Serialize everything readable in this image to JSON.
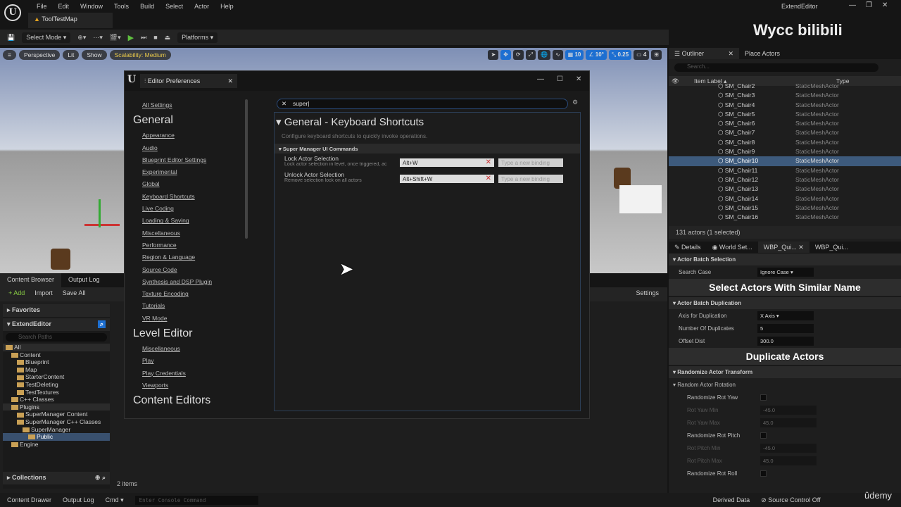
{
  "app": {
    "logo": "U",
    "menu": [
      "File",
      "Edit",
      "Window",
      "Tools",
      "Build",
      "Select",
      "Actor",
      "Help"
    ],
    "map_tab": "ToolTestMap",
    "window_title": "ExtendEditor",
    "watermark": "Wycc bilibili",
    "udemy": "ûdemy"
  },
  "toolbar": {
    "select_mode": "Select Mode",
    "platforms": "Platforms"
  },
  "viewport": {
    "perspective": "Perspective",
    "lit": "Lit",
    "show": "Show",
    "scalability": "Scalability: Medium",
    "grid": "10",
    "angle": "10°",
    "scale": "0.25",
    "camera": "4"
  },
  "content_browser": {
    "tabs": [
      "Content Browser",
      "Output Log"
    ],
    "add": "+ Add",
    "import": "Import",
    "save_all": "Save All",
    "settings": "Settings",
    "favorites": "Favorites",
    "project": "ExtendEditor",
    "search_paths": "Search Paths",
    "tree": [
      {
        "label": "All",
        "depth": 0
      },
      {
        "label": "Content",
        "depth": 1
      },
      {
        "label": "Blueprint",
        "depth": 2
      },
      {
        "label": "Map",
        "depth": 2
      },
      {
        "label": "StarterContent",
        "depth": 2
      },
      {
        "label": "TestDeleting",
        "depth": 2
      },
      {
        "label": "TestTextures",
        "depth": 2
      },
      {
        "label": "C++ Classes",
        "depth": 1
      },
      {
        "label": "Plugins",
        "depth": 1
      },
      {
        "label": "SuperManager Content",
        "depth": 2
      },
      {
        "label": "SuperManager C++ Classes",
        "depth": 2
      },
      {
        "label": "SuperManager",
        "depth": 3
      },
      {
        "label": "Public",
        "depth": 4
      },
      {
        "label": "Engine",
        "depth": 1
      }
    ],
    "collections": "Collections",
    "items": "2 items"
  },
  "status": {
    "content_drawer": "Content Drawer",
    "output_log": "Output Log",
    "cmd": "Cmd",
    "console_placeholder": "Enter Console Command",
    "derived_data": "Derived Data",
    "source_control": "Source Control Off"
  },
  "prefs": {
    "title": "Editor Preferences",
    "all_settings": "All Settings",
    "general": "General",
    "general_items": [
      "Appearance",
      "Audio",
      "Blueprint Editor Settings",
      "Experimental",
      "Global",
      "Keyboard Shortcuts",
      "Live Coding",
      "Loading & Saving",
      "Miscellaneous",
      "Performance",
      "Region & Language",
      "Source Code",
      "Synthesis and DSP Plugin",
      "Texture Encoding",
      "Tutorials",
      "VR Mode"
    ],
    "level_editor": "Level Editor",
    "level_items": [
      "Miscellaneous",
      "Play",
      "Play Credentials",
      "Viewports"
    ],
    "content_editors": "Content Editors",
    "search": "super",
    "section_title": "General - Keyboard Shortcuts",
    "section_desc": "Configure keyboard shortcuts to quickly invoke operations.",
    "group": "Super Manager UI Commands",
    "placeholder": "Type a new binding",
    "commands": [
      {
        "name": "Lock Actor Selection",
        "desc": "Lock actor selection in level, once triggered, ac",
        "key": "Alt+W"
      },
      {
        "name": "Unlock Actor Selection",
        "desc": "Remove selection lock on all actors",
        "key": "Alt+Shift+W"
      }
    ]
  },
  "outliner": {
    "tab": "Outliner",
    "place": "Place Actors",
    "search": "Search...",
    "col_label": "Item Label",
    "col_type": "Type",
    "rows": [
      "SM_Chair2",
      "SM_Chair3",
      "SM_Chair4",
      "SM_Chair5",
      "SM_Chair6",
      "SM_Chair7",
      "SM_Chair8",
      "SM_Chair9",
      "SM_Chair10",
      "SM_Chair11",
      "SM_Chair12",
      "SM_Chair13",
      "SM_Chair14",
      "SM_Chair15",
      "SM_Chair16"
    ],
    "type": "StaticMeshActor",
    "count": "131 actors (1 selected)"
  },
  "details": {
    "tabs": [
      "Details",
      "World Set...",
      "WBP_Qui...",
      "WBP_Qui..."
    ],
    "batch_sel": "Actor Batch Selection",
    "search_case": "Search Case",
    "search_case_val": "Ignore Case",
    "select_btn": "Select Actors With Similar Name",
    "batch_dup": "Actor Batch Duplication",
    "axis": "Axis for Duplication",
    "axis_val": "X Axis",
    "num": "Number Of Duplicates",
    "num_val": "5",
    "offset": "Offset Dist",
    "offset_val": "300.0",
    "dup_btn": "Duplicate Actors",
    "rand": "Randomize Actor Transform",
    "rand_rot": "Random Actor Rotation",
    "yaw": "Randomize Rot Yaw",
    "yaw_min": "Rot Yaw Min",
    "yaw_min_val": "-45.0",
    "yaw_max": "Rot Yaw Max",
    "yaw_max_val": "45.0",
    "pitch": "Randomize Rot Pitch",
    "pitch_min": "Rot Pitch Min",
    "pitch_min_val": "-45.0",
    "pitch_max": "Rot Pitch Max",
    "pitch_max_val": "45.0",
    "roll": "Randomize Rot Roll"
  }
}
